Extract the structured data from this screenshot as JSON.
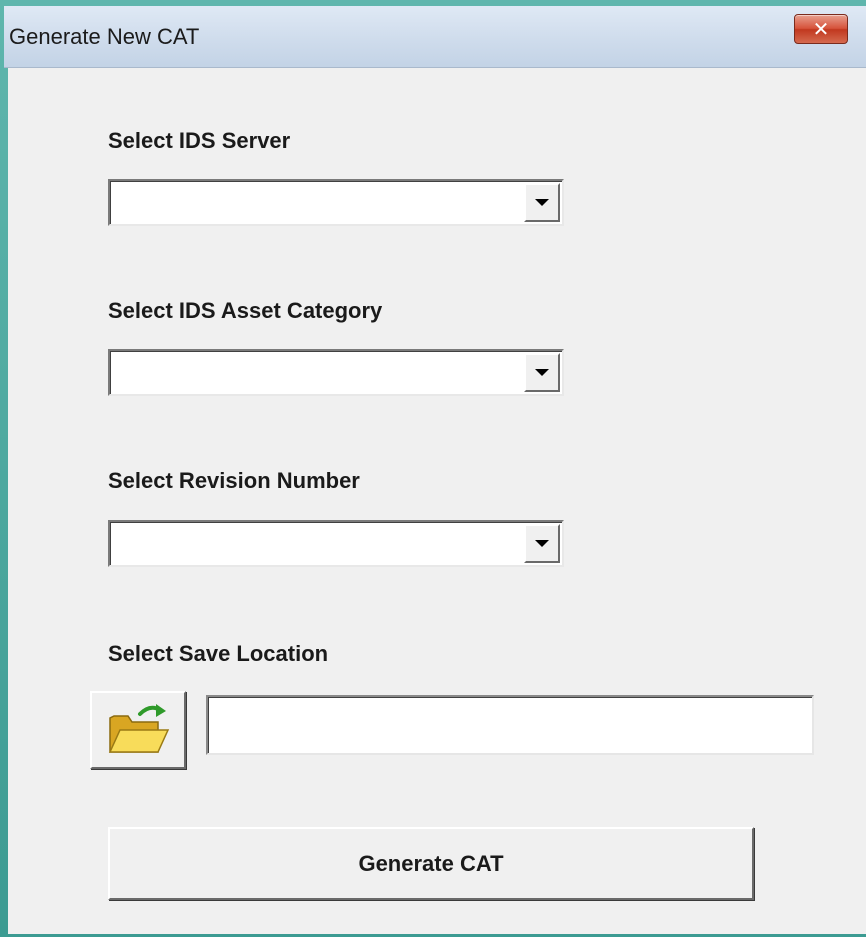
{
  "window": {
    "title": "Generate New CAT",
    "close_glyph": "✕"
  },
  "form": {
    "ids_server": {
      "label": "Select IDS Server",
      "value": ""
    },
    "asset_category": {
      "label": "Select IDS Asset Category",
      "value": ""
    },
    "revision_number": {
      "label": "Select Revision Number",
      "value": ""
    },
    "save_location": {
      "label": "Select Save Location",
      "value": "",
      "browse_icon": "open-folder-icon"
    },
    "generate_label": "Generate CAT"
  },
  "colors": {
    "client_bg": "#f0f0f0",
    "title_bg": "#d3dfee",
    "close_button": "#c9452b",
    "folder_yellow": "#f5d64a",
    "arrow_green": "#2f9a2a"
  }
}
